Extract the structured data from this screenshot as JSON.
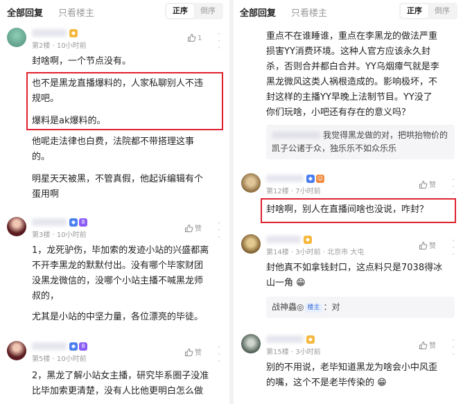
{
  "header": {
    "tab_all": "全部回复",
    "tab_op": "只看楼主",
    "order_asc": "正序",
    "order_desc": "倒序"
  },
  "left": {
    "comments": [
      {
        "meta": "第2楼 · 10小时前",
        "like": "1",
        "lines": [
          "封啥啊，一个节点没有。"
        ],
        "boxed": [
          "也不是黑龙直播爆料的，人家私聊别人不违",
          "规吧。",
          "爆料是ak爆料的。"
        ],
        "after": [
          "他呢走法律也白费，法院都不带搭理这事",
          "的。",
          "明星天天被黑，不管真假，他起诉编辑有个",
          "蛋用啊"
        ]
      },
      {
        "meta": "第3楼 · 10小时前",
        "like": "赞",
        "lines": [
          "1，龙死驴伤，毕加索的发迹小站的兴盛都离",
          "不开李黑龙的默默付出。没有哪个毕家财团",
          "没黑龙微信的，没哪个小站主播不喊黑龙师",
          "叔的，",
          "尤其是小站的中坚力量，各位漂亮的毕徒。"
        ]
      },
      {
        "meta": "第5楼 · 10小时前",
        "like": "赞",
        "lines": [
          "2，黑龙了解小站女主播，研究毕系圈子没准",
          "比毕加索更清楚，没有人比他更明白怎么做"
        ]
      }
    ]
  },
  "right": {
    "top_lines": [
      "重点不在谁睡谁，重点在李黑龙的做法严重",
      "损害YY消费环境。这种人官方应该永久封",
      "杀，否则合并都白合并。YY乌烟瘴气就是李",
      "黑龙微风这类人祸根造成的。影响极坏，不",
      "封这样的主播YY早晚上法制节目。YY没了",
      "你们玩啥，小吧还有存在的意义吗？"
    ],
    "top_reply": "我觉得黑龙做的对，把哄抬物价的凯子公诸于众，独乐乐不如众乐乐",
    "comments": [
      {
        "meta": "第12楼 · 7小时前",
        "like": "赞",
        "boxed": "封啥啊，别人在直播间啥也没说，咋封？"
      },
      {
        "meta": "第14楼 · 3小时前 · 北京市 大屯",
        "like": "赞",
        "lines": [
          "封他真不如拿钱封口，这点料只是7038得冰",
          "山一角 😁"
        ],
        "reply_name": "战神蟲◎",
        "reply_tag": "楼主",
        "reply_text": "：对"
      },
      {
        "meta": "第15楼 · 3小时前",
        "like": "赞",
        "lines": [
          "别的不用说，老毕知道黑龙为啥会小中风歪",
          "的嘴，这个不是老毕传染的 😁"
        ]
      }
    ]
  },
  "colors": {
    "accent_red": "#e0202e",
    "muted": "#9a9a9a",
    "badge_blue": "#4a7ff0",
    "badge_purple": "#8b5cf6",
    "badge_gold": "#f5b83d"
  }
}
